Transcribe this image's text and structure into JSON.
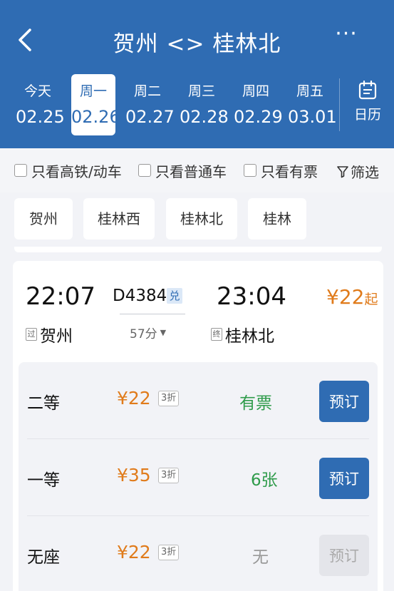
{
  "header": {
    "title": "贺州 <> 桂林北",
    "more": "···",
    "dates": [
      {
        "weekday": "今天",
        "date": "02.25",
        "active": false
      },
      {
        "weekday": "周一",
        "date": "02.26",
        "active": true
      },
      {
        "weekday": "周二",
        "date": "02.27",
        "active": false
      },
      {
        "weekday": "周三",
        "date": "02.28",
        "active": false
      },
      {
        "weekday": "周四",
        "date": "02.29",
        "active": false
      },
      {
        "weekday": "周五",
        "date": "03.01",
        "active": false
      }
    ],
    "calendar_label": "日历"
  },
  "filters": {
    "high_speed_only": "只看高铁/动车",
    "regular_only": "只看普通车",
    "available_only": "只看有票",
    "filter_label": "筛选"
  },
  "stations": [
    "贺州",
    "桂林西",
    "桂林北",
    "桂林"
  ],
  "train": {
    "departure_time": "22:07",
    "arrival_time": "23:04",
    "train_number": "D4384",
    "exchange_badge": "兑",
    "duration": "57分",
    "price_from": "¥22",
    "price_suffix": "起",
    "from_tag": "过",
    "from_station": "贺州",
    "to_tag": "终",
    "to_station": "桂林北",
    "seats": [
      {
        "class": "二等",
        "price": "¥22",
        "discount": "3折",
        "availability": "有票",
        "book_label": "预订",
        "available": true
      },
      {
        "class": "一等",
        "price": "¥35",
        "discount": "3折",
        "availability": "6张",
        "book_label": "预订",
        "available": true
      },
      {
        "class": "无座",
        "price": "¥22",
        "discount": "3折",
        "availability": "无",
        "book_label": "预订",
        "available": false
      }
    ]
  },
  "colors": {
    "brand_blue": "#2f6cb3",
    "price_orange": "#e07b1b",
    "available_green": "#2e9b4a"
  }
}
